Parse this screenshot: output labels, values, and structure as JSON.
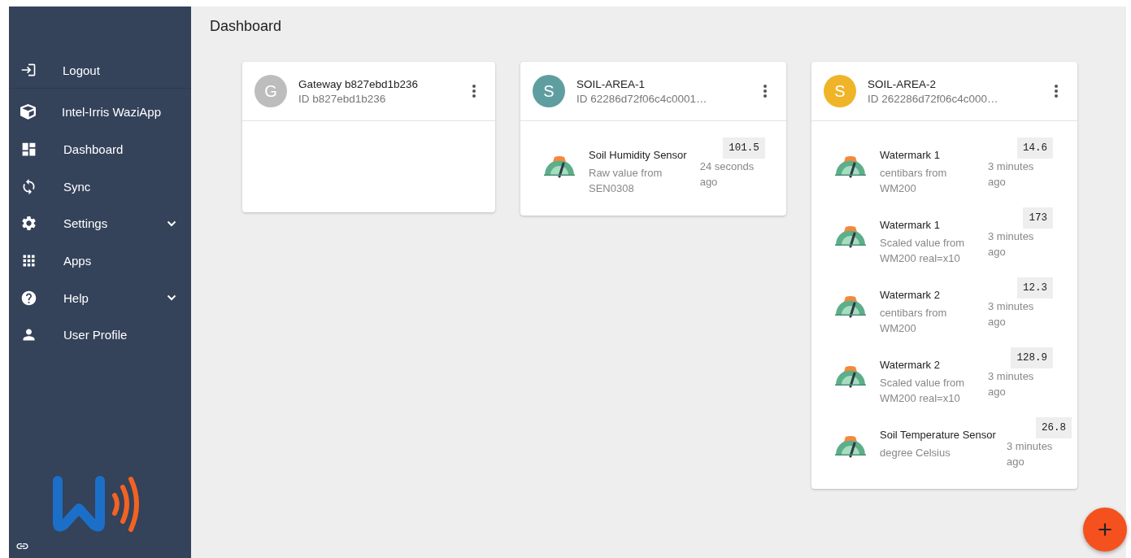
{
  "sidebar": {
    "logout": {
      "label": "Logout"
    },
    "items": [
      {
        "label": "Intel-Irris WaziApp",
        "expandable": false
      },
      {
        "label": "Dashboard",
        "expandable": false
      },
      {
        "label": "Sync",
        "expandable": false
      },
      {
        "label": "Settings",
        "expandable": true
      },
      {
        "label": "Apps",
        "expandable": false
      },
      {
        "label": "Help",
        "expandable": true
      },
      {
        "label": "User Profile",
        "expandable": false
      }
    ]
  },
  "page": {
    "title": "Dashboard"
  },
  "cards": [
    {
      "avatar": "G",
      "color": "#bdbdbd",
      "title": "Gateway b827ebd1b236",
      "subtitle": "ID b827ebd1b236"
    },
    {
      "avatar": "S",
      "color": "#5f9ea0",
      "title": "SOIL-AREA-1",
      "subtitle": "ID 62286d72f06c4c0001…",
      "sensors": [
        {
          "name": "Soil Humidity Sensor",
          "description": "Raw value from SEN0308",
          "value": "101.5",
          "time": "24 seconds ago"
        }
      ]
    },
    {
      "avatar": "S",
      "color": "#f0b429",
      "title": "SOIL-AREA-2",
      "subtitle": "ID 262286d72f06c4c000…",
      "sensors": [
        {
          "name": "Watermark 1",
          "description": "centibars from WM200",
          "value": "14.6",
          "time": "3 minutes ago"
        },
        {
          "name": "Watermark 1",
          "description": "Scaled value from WM200 real=x10",
          "value": "173",
          "time": "3 minutes ago"
        },
        {
          "name": "Watermark 2",
          "description": "centibars from WM200",
          "value": "12.3",
          "time": "3 minutes ago"
        },
        {
          "name": "Watermark 2",
          "description": "Scaled value from WM200 real=x10",
          "value": "128.9",
          "time": "3 minutes ago"
        },
        {
          "name": "Soil Temperature Sensor",
          "description": "degree Celsius",
          "value": "26.8",
          "time": "3 minutes ago"
        }
      ]
    }
  ]
}
